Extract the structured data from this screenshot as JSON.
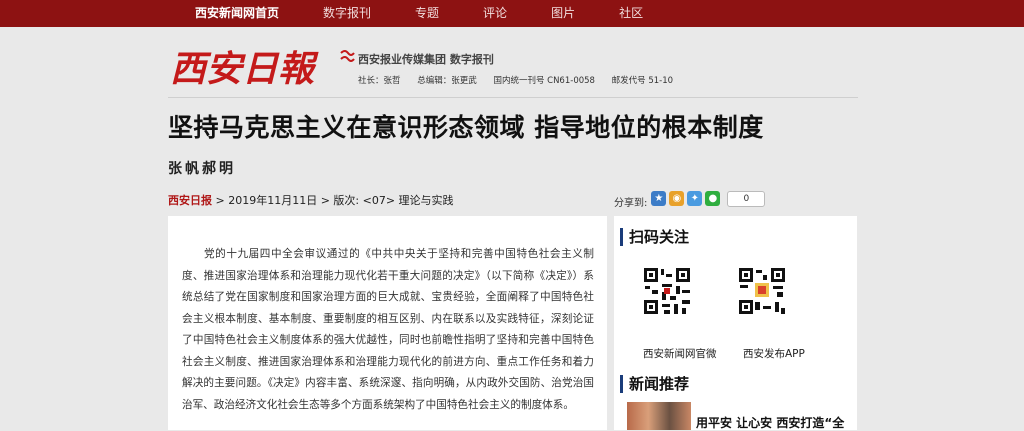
{
  "nav": {
    "items": [
      "西安新闻网首页",
      "数字报刊",
      "专题",
      "评论",
      "图片",
      "社区"
    ]
  },
  "header": {
    "logo_text": "西安日報",
    "publisher": "西安报业传媒集团 数字报刊",
    "meta": [
      "社长：张哲",
      "总编辑：张更武",
      "国内统一刊号 CN61-0058",
      "邮发代号 51-10"
    ]
  },
  "article": {
    "title": "坚持马克思主义在意识形态领域 指导地位的根本制度",
    "author": "张帆郝明",
    "paper_name": "西安日报",
    "info": " > 2019年11月11日 >  版次:   <07> 理论与实践",
    "body": "党的十九届四中全会审议通过的《中共中央关于坚持和完善中国特色社会主义制度、推进国家治理体系和治理能力现代化若干重大问题的决定》（以下简称《决定》）系统总结了党在国家制度和国家治理方面的巨大成就、宝贵经验，全面阐释了中国特色社会主义根本制度、基本制度、重要制度的相互区别、内在联系以及实践特征，深刻论证了中国特色社会主义制度体系的强大优越性，同时也前瞻性指明了坚持和完善中国特色社会主义制度、推进国家治理体系和治理能力现代化的前进方向、重点工作任务和着力解决的主要问题。《决定》内容丰富、系统深邃、指向明确，从内政外交国防、治党治国治军、政治经济文化社会生态等多个方面系统架构了中国特色社会主义的制度体系。"
  },
  "share": {
    "label": "分享到:",
    "count": "0",
    "icons": [
      "star-icon",
      "weibo-icon",
      "qzone-icon",
      "wechat-icon"
    ]
  },
  "sidebar": {
    "scan_title": "扫码关注",
    "qr_labels": [
      "西安新闻网官微",
      "西安发布APP"
    ],
    "news_title": "新闻推荐",
    "news_item": "用平安 让心安 西安打造“全"
  },
  "colors": {
    "nav_bg": "#8d1212",
    "paper_red": "#b01818",
    "section_accent": "#1a3c7a"
  }
}
